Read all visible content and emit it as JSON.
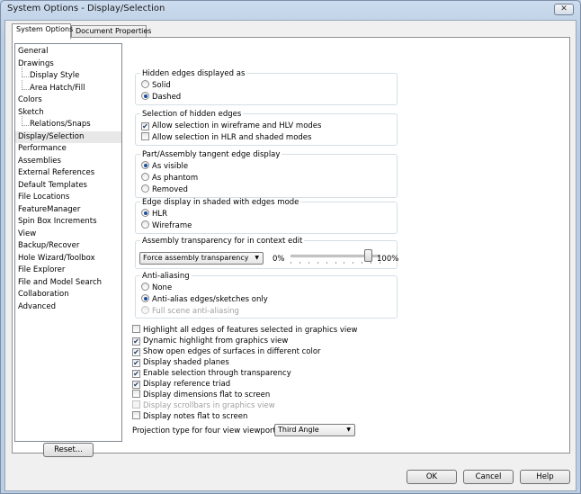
{
  "window": {
    "title": "System Options - Display/Selection",
    "close_glyph": "✕"
  },
  "tabs": [
    {
      "label": "System Options",
      "active": true
    },
    {
      "label": "Document Properties",
      "active": false
    }
  ],
  "sidebar": {
    "items": [
      {
        "label": "General",
        "level": 0,
        "selected": false
      },
      {
        "label": "Drawings",
        "level": 0,
        "selected": false
      },
      {
        "label": "Display Style",
        "level": 1,
        "selected": false
      },
      {
        "label": "Area Hatch/Fill",
        "level": 1,
        "selected": false
      },
      {
        "label": "Colors",
        "level": 0,
        "selected": false
      },
      {
        "label": "Sketch",
        "level": 0,
        "selected": false
      },
      {
        "label": "Relations/Snaps",
        "level": 1,
        "selected": false
      },
      {
        "label": "Display/Selection",
        "level": 0,
        "selected": true
      },
      {
        "label": "Performance",
        "level": 0,
        "selected": false
      },
      {
        "label": "Assemblies",
        "level": 0,
        "selected": false
      },
      {
        "label": "External References",
        "level": 0,
        "selected": false
      },
      {
        "label": "Default Templates",
        "level": 0,
        "selected": false
      },
      {
        "label": "File Locations",
        "level": 0,
        "selected": false
      },
      {
        "label": "FeatureManager",
        "level": 0,
        "selected": false
      },
      {
        "label": "Spin Box Increments",
        "level": 0,
        "selected": false
      },
      {
        "label": "View",
        "level": 0,
        "selected": false
      },
      {
        "label": "Backup/Recover",
        "level": 0,
        "selected": false
      },
      {
        "label": "Hole Wizard/Toolbox",
        "level": 0,
        "selected": false
      },
      {
        "label": "File Explorer",
        "level": 0,
        "selected": false
      },
      {
        "label": "File and Model Search",
        "level": 0,
        "selected": false
      },
      {
        "label": "Collaboration",
        "level": 0,
        "selected": false
      },
      {
        "label": "Advanced",
        "level": 0,
        "selected": false
      }
    ],
    "reset_label": "Reset..."
  },
  "hidden_edges": {
    "title": "Hidden edges displayed as",
    "options": [
      {
        "label": "Solid",
        "selected": false
      },
      {
        "label": "Dashed",
        "selected": true
      }
    ]
  },
  "hidden_selection": {
    "title": "Selection of hidden edges",
    "options": [
      {
        "label": "Allow selection in wireframe and HLV modes",
        "checked": true
      },
      {
        "label": "Allow selection in HLR and shaded modes",
        "checked": false
      }
    ]
  },
  "tangent_edge": {
    "title": "Part/Assembly tangent edge display",
    "options": [
      {
        "label": "As visible",
        "selected": true
      },
      {
        "label": "As phantom",
        "selected": false
      },
      {
        "label": "Removed",
        "selected": false
      }
    ]
  },
  "shaded_edges": {
    "title": "Edge display in shaded with edges mode",
    "options": [
      {
        "label": "HLR",
        "selected": true
      },
      {
        "label": "Wireframe",
        "selected": false
      }
    ]
  },
  "transparency": {
    "title": "Assembly transparency for in context edit",
    "dropdown_value": "Force assembly transparency",
    "min_label": "0%",
    "max_label": "100%",
    "slider_value": 0.9
  },
  "anti_aliasing": {
    "title": "Anti-aliasing",
    "options": [
      {
        "label": "None",
        "selected": false,
        "disabled": false
      },
      {
        "label": "Anti-alias edges/sketches only",
        "selected": true,
        "disabled": false
      },
      {
        "label": "Full scene anti-aliasing",
        "selected": false,
        "disabled": true
      }
    ]
  },
  "checkboxes": [
    {
      "label": "Highlight all edges of features selected in graphics view",
      "checked": false,
      "disabled": false
    },
    {
      "label": "Dynamic highlight from graphics view",
      "checked": true,
      "disabled": false
    },
    {
      "label": "Show open edges of surfaces in different color",
      "checked": true,
      "disabled": false
    },
    {
      "label": "Display shaded planes",
      "checked": true,
      "disabled": false
    },
    {
      "label": "Enable selection through transparency",
      "checked": true,
      "disabled": false
    },
    {
      "label": "Display reference triad",
      "checked": true,
      "disabled": false
    },
    {
      "label": "Display dimensions flat to screen",
      "checked": false,
      "disabled": false
    },
    {
      "label": "Display scrollbars in graphics view",
      "checked": false,
      "disabled": true
    },
    {
      "label": "Display notes flat to screen",
      "checked": false,
      "disabled": false
    }
  ],
  "projection": {
    "label": "Projection type for four view viewport:",
    "value": "Third Angle"
  },
  "footer": {
    "ok_label": "OK",
    "cancel_label": "Cancel",
    "help_label": "Help"
  },
  "check_glyph": "✔",
  "dropdown_glyph": "▼"
}
